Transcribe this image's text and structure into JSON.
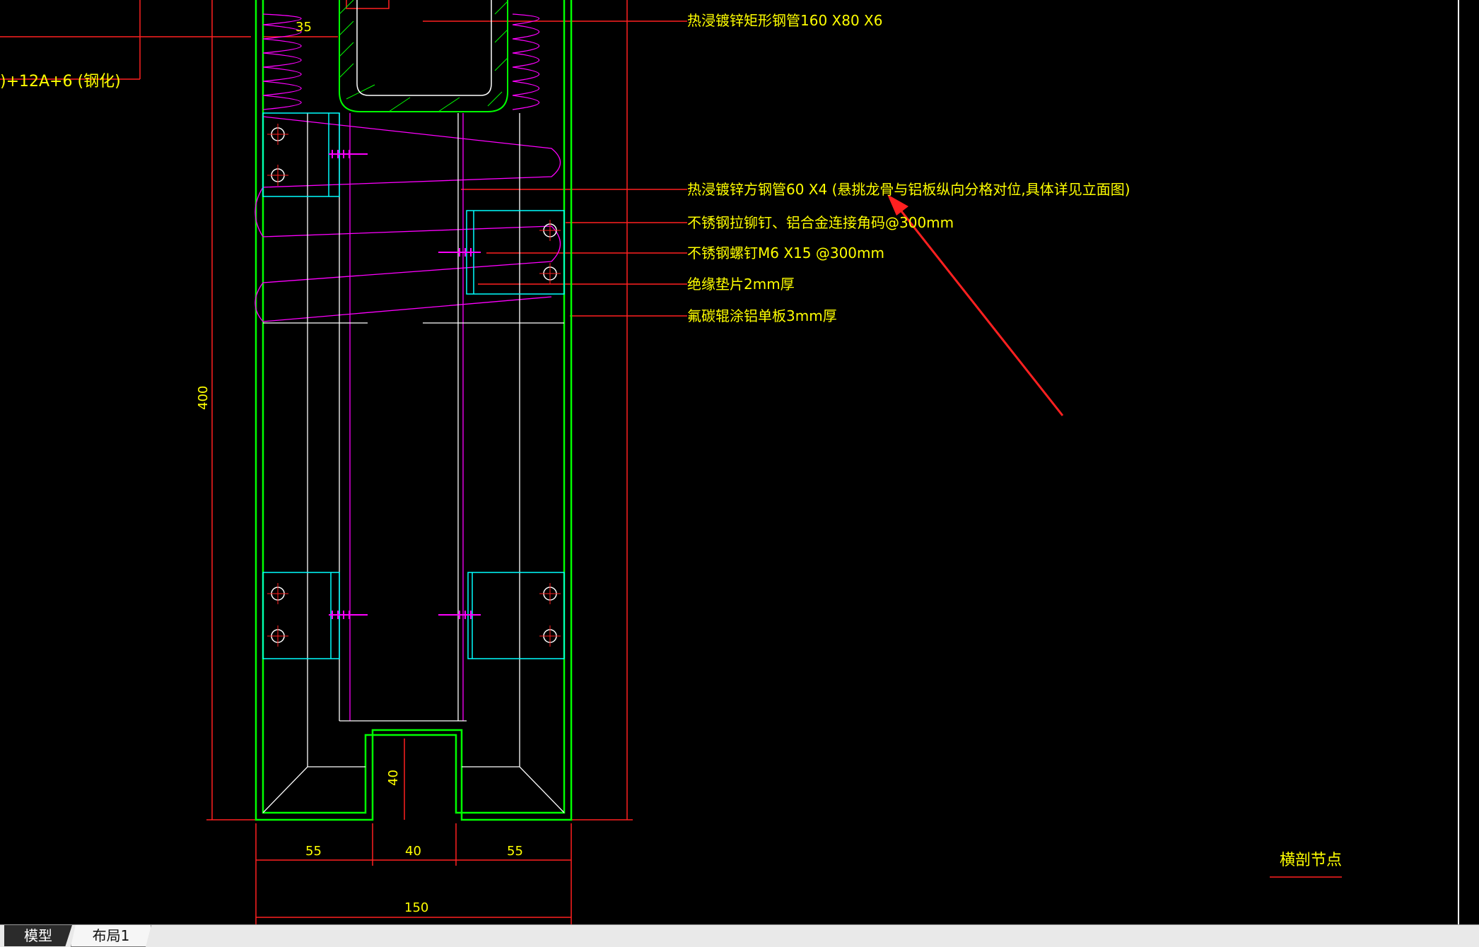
{
  "drawing": {
    "title_block": {
      "text": "横剖节点",
      "color": "#ffff00"
    },
    "annotations": [
      "热浸镀锌矩形钢管160 X80 X6",
      "热浸镀锌方钢管60 X4 (悬挑龙骨与铝板纵向分格对位,具体详见立面图)",
      "不锈钢拉铆钉、铝合金连接角码@300mm",
      "不锈钢螺钉M6 X15 @300mm",
      "绝缘垫片2mm厚",
      "氟碳辊涂铝单板3mm厚"
    ],
    "left_partial_label": ")+12A+6 (钢化)",
    "dimensions": {
      "top_35": "35",
      "height_400": "400",
      "slot_40": "40",
      "bottom_55_left": "55",
      "bottom_40": "40",
      "bottom_55_right": "55",
      "total_150": "150"
    },
    "colors": {
      "background": "#000000",
      "text": "#ffff00",
      "dimension": "#ff0000",
      "frame": "#00ff00",
      "insulation": "#ff00ff",
      "bracket": "#00ffff",
      "structure": "#ffffff",
      "arrow": "#ff2020"
    }
  },
  "tabs": {
    "model": "模型",
    "layout1": "布局1"
  }
}
